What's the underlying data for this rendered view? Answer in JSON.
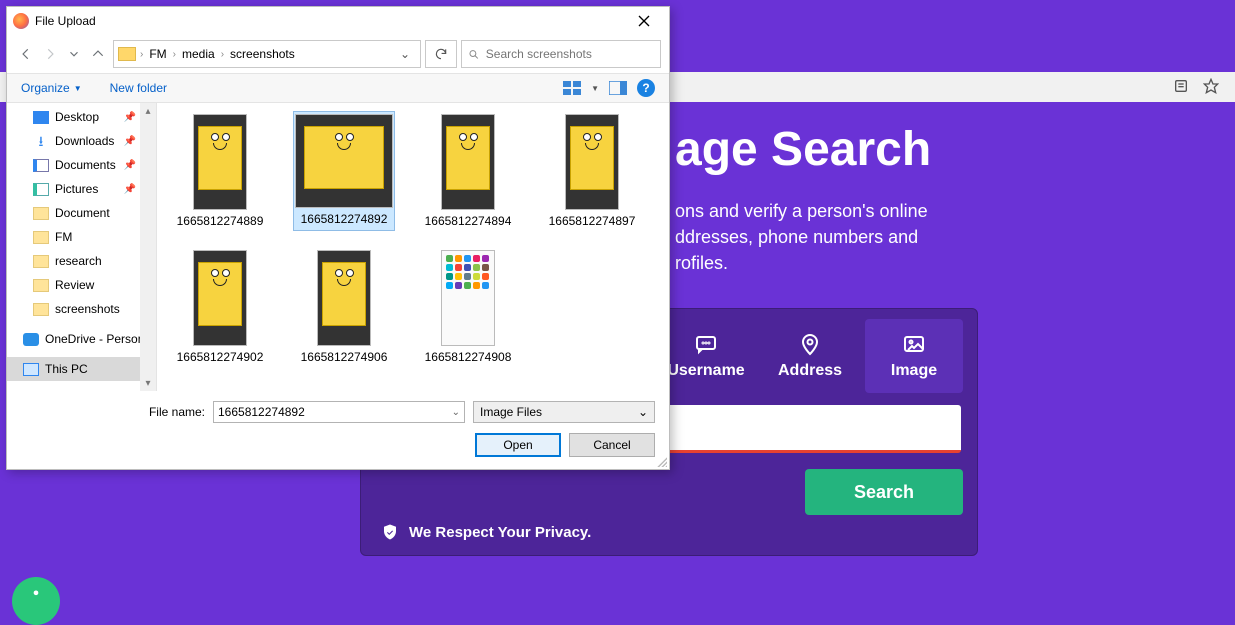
{
  "site": {
    "heading_partial": "age Search",
    "desc_line1": "ons and verify a person's online",
    "desc_line2": "ddresses, phone numbers and",
    "desc_line3": "rofiles.",
    "tabs": {
      "username": "Username",
      "address": "Address",
      "image": "Image"
    },
    "search_btn": "Search",
    "privacy": "We Respect Your Privacy."
  },
  "dialog": {
    "title": "File Upload",
    "breadcrumb": [
      "FM",
      "media",
      "screenshots"
    ],
    "search_placeholder": "Search screenshots",
    "organize": "Organize",
    "new_folder": "New folder",
    "sidebar": [
      {
        "label": "Desktop",
        "icon": "desk",
        "pin": true
      },
      {
        "label": "Downloads",
        "icon": "dl",
        "pin": true
      },
      {
        "label": "Documents",
        "icon": "doc",
        "pin": true
      },
      {
        "label": "Pictures",
        "icon": "pic",
        "pin": true
      },
      {
        "label": "Document",
        "icon": "folder",
        "pin": false
      },
      {
        "label": "FM",
        "icon": "folder",
        "pin": false
      },
      {
        "label": "research",
        "icon": "folder",
        "pin": false
      },
      {
        "label": "Review",
        "icon": "folder",
        "pin": false
      },
      {
        "label": "screenshots",
        "icon": "folder",
        "pin": false
      }
    ],
    "onedrive": "OneDrive - Person",
    "thispc": "This PC",
    "files": [
      {
        "name": "1665812274889",
        "kind": "phone-yellow",
        "selected": false
      },
      {
        "name": "1665812274892",
        "kind": "phone-yellow",
        "selected": true
      },
      {
        "name": "1665812274894",
        "kind": "phone-yellow",
        "selected": false
      },
      {
        "name": "1665812274897",
        "kind": "phone-yellow",
        "selected": false
      },
      {
        "name": "1665812274902",
        "kind": "phone-yellow",
        "selected": false
      },
      {
        "name": "1665812274906",
        "kind": "phone-yellow",
        "selected": false
      },
      {
        "name": "1665812274908",
        "kind": "app-grid",
        "selected": false
      }
    ],
    "filename_label": "File name:",
    "filename_value": "1665812274892",
    "filetype": "Image Files",
    "open": "Open",
    "cancel": "Cancel"
  }
}
